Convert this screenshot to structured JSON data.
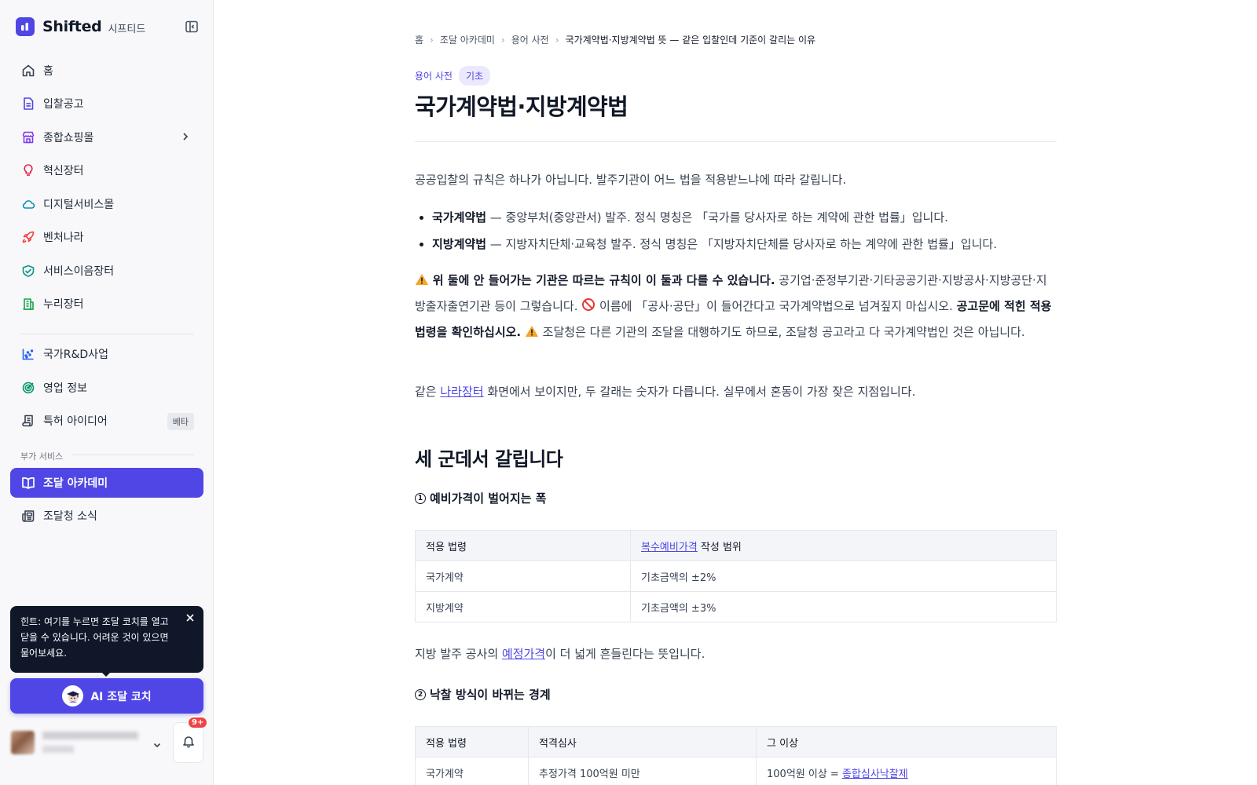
{
  "app": {
    "name": "Shifted",
    "name_sub": "시프티드"
  },
  "sidebar": {
    "items": [
      {
        "label": "홈",
        "icon": "home-icon"
      },
      {
        "label": "입찰공고",
        "icon": "document-icon"
      },
      {
        "label": "종합쇼핑몰",
        "icon": "store-icon"
      },
      {
        "label": "혁신장터",
        "icon": "lightbulb-icon"
      },
      {
        "label": "디지털서비스몰",
        "icon": "cloud-icon"
      },
      {
        "label": "벤처나라",
        "icon": "rocket-icon"
      },
      {
        "label": "서비스이음장터",
        "icon": "handshake-icon"
      },
      {
        "label": "누리장터",
        "icon": "building-icon"
      },
      {
        "label": "국가R&D사업",
        "icon": "scatter-chart-icon"
      },
      {
        "label": "영업 정보",
        "icon": "target-icon"
      },
      {
        "label": "특허 아이디어",
        "icon": "scroll-icon",
        "badge": "베타"
      },
      {
        "label": "조달 아카데미",
        "icon": "book-icon"
      },
      {
        "label": "조달청 소식",
        "icon": "newspaper-icon"
      }
    ],
    "section_label": "부가 서비스",
    "active_index": 11,
    "tooltip": "힌트: 여기를 누르면 조달 코치를 열고 닫을 수 있습니다. 어려운 것이 있으면 물어보세요.",
    "coach_button": "AI 조달 코치",
    "notification_count": "9+"
  },
  "article": {
    "breadcrumb": [
      "홈",
      "조달 아카데미",
      "용어 사전",
      "국가계약법·지방계약법 뜻 — 같은 입찰인데 기준이 갈리는 이유"
    ],
    "category": "용어 사전",
    "level": "기초",
    "title": "국가계약법·지방계약법",
    "intro": "공공입찰의 규칙은 하나가 아닙니다. 발주기관이 어느 법을 적용받느냐에 따라 갈립니다.",
    "bullets": [
      {
        "term": "국가계약법",
        "text": " — 중앙부처(중앙관서) 발주. 정식 명칭은 「국가를 당사자로 하는 계약에 관한 법률」입니다."
      },
      {
        "term": "지방계약법",
        "text": " — 지방자치단체·교육청 발주. 정식 명칭은 「지방자치단체를 당사자로 하는 계약에 관한 법률」입니다."
      }
    ],
    "note": {
      "strong1": "위 둘에 안 들어가는 기관은 따르는 규칙이 이 둘과 다를 수 있습니다.",
      "text1": " 공기업·준정부기관·기타공공기관·지방공사·지방공단·지방출자출연기관 등이 그렇습니다. ",
      "text2": " 이름에 「공사·공단」이 들어간다고 국가계약법으로 넘겨짚지 마십시오. ",
      "strong2": "공고문에 적힌 적용 법령을 확인하십시오.",
      "text3": " 조달청은 다른 기관의 조달을 대행하기도 하므로, 조달청 공고라고 다 국가계약법인 것은 아닙니다."
    },
    "para2": {
      "before": "같은 ",
      "link": "나라장터",
      "after": " 화면에서 보이지만, 두 갈래는 숫자가 다릅니다. 실무에서 혼동이 가장 잦은 지점입니다."
    },
    "section_title": "세 군데서 갈립니다",
    "sub1": {
      "num": "1",
      "title": "예비가격이 벌어지는 폭"
    },
    "table1": {
      "headers": [
        "적용 법령",
        "작성 범위"
      ],
      "header_link": "복수예비가격",
      "rows": [
        [
          "국가계약",
          "기초금액의 ±2%"
        ],
        [
          "지방계약",
          "기초금액의 ±3%"
        ]
      ]
    },
    "para3": {
      "before": "지방 발주 공사의 ",
      "link": "예정가격",
      "after": "이 더 넓게 흔들린다는 뜻입니다."
    },
    "sub2": {
      "num": "2",
      "title": "낙찰 방식이 바뀌는 경계"
    },
    "table2": {
      "headers": [
        "적용 법령",
        "적격심사",
        "그 이상"
      ],
      "rows": [
        {
          "law": "국가계약",
          "exam": "추정가격 100억원 미만",
          "above_text": "100억원 이상 = ",
          "above_link": "종합심사낙찰제"
        }
      ]
    }
  }
}
